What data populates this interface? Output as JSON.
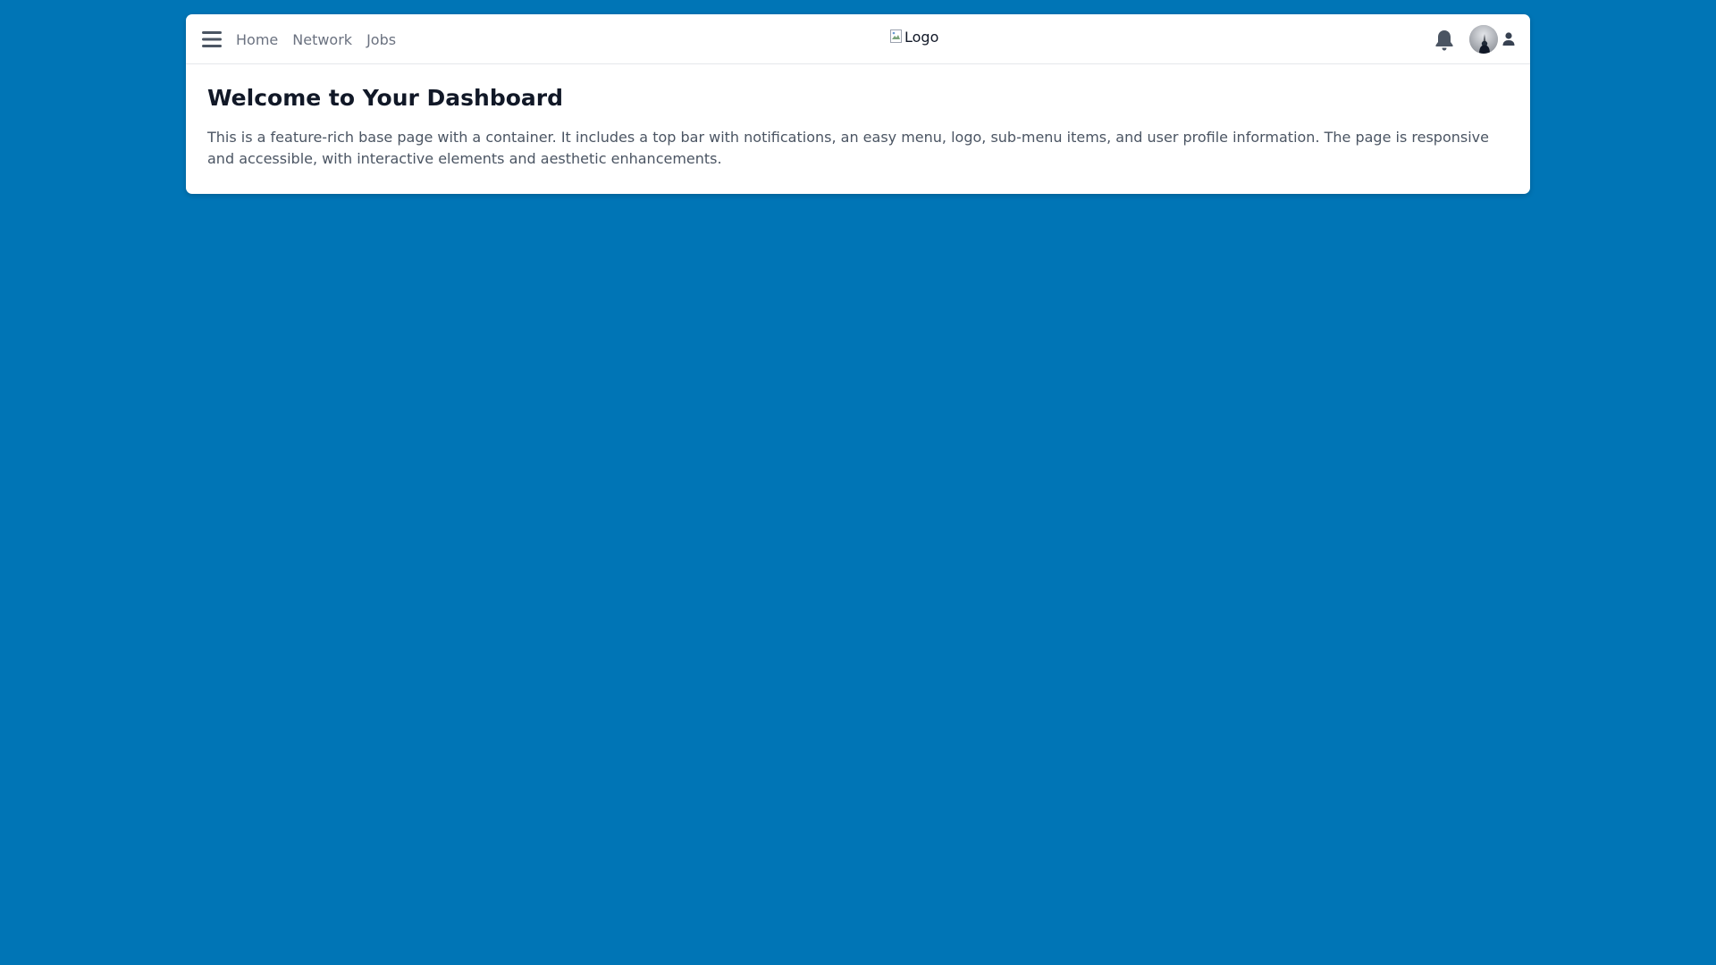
{
  "topbar": {
    "menu_icon": "hamburger-menu-icon",
    "nav": [
      "Home",
      "Network",
      "Jobs"
    ],
    "logo_alt": "Logo",
    "notifications_icon": "bell-icon",
    "avatar_icon": "avatar",
    "profile_icon": "user-icon"
  },
  "main": {
    "title": "Welcome to Your Dashboard",
    "description": "This is a feature-rich base page with a container. It includes a top bar with notifications, an easy menu, logo, sub-menu items, and user profile information. The page is responsive and accessible, with interactive elements and aesthetic enhancements."
  },
  "colors": {
    "background": "#0075b6",
    "card": "#ffffff",
    "nav_text": "#6b7280",
    "title_text": "#111827",
    "body_text": "#4b5563"
  }
}
